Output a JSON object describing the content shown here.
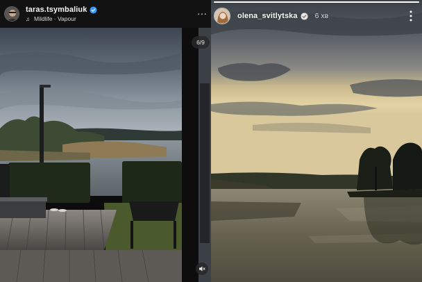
{
  "left_story": {
    "username": "taras.tsymbaliuk",
    "verified": true,
    "music_icon": "music-note-icon",
    "music_label": "Mildlife · Vapour",
    "more_label": "···",
    "counter": "6/9",
    "mute_icon": "speaker-muted-icon"
  },
  "right_story": {
    "username": "olena_svitlytska",
    "verified": true,
    "time_ago": "6 хв",
    "more_icon": "vertical-ellipsis-icon",
    "progress": 1.0
  },
  "colors": {
    "verified_blue": "#3897f0",
    "header_bg": "#121212",
    "sunset_sky": "#d9c79a",
    "water": "#6f6a58"
  }
}
